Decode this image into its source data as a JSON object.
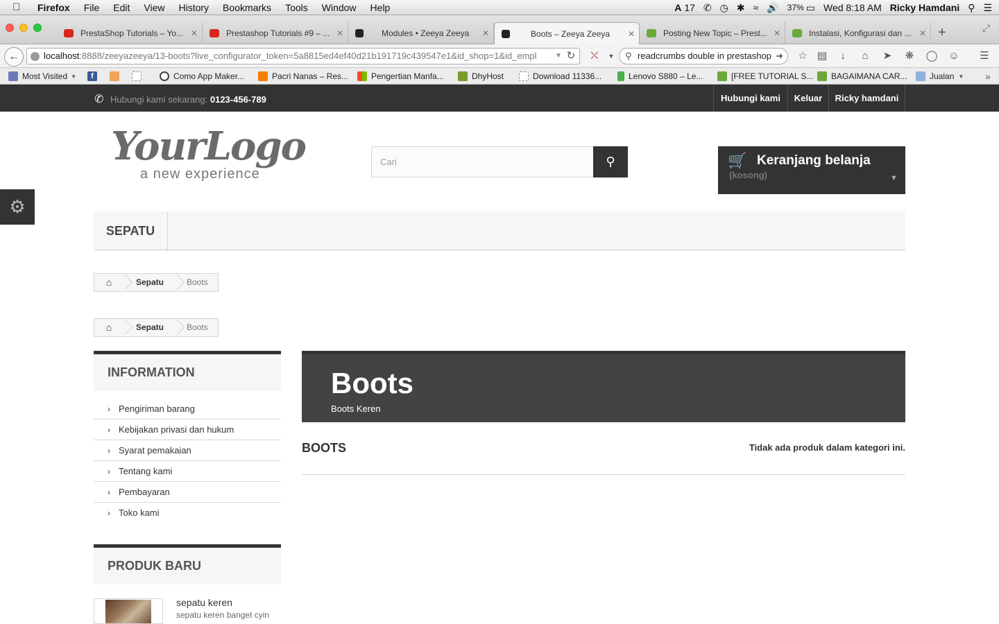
{
  "os_menubar": {
    "app": "Firefox",
    "menus": [
      "File",
      "Edit",
      "View",
      "History",
      "Bookmarks",
      "Tools",
      "Window",
      "Help"
    ],
    "adobe_count": "17",
    "battery": "37%",
    "clock": "Wed 8:18 AM",
    "user": "Ricky Hamdani"
  },
  "browser": {
    "tabs": [
      {
        "label": "PrestaShop Tutorials – Yo...",
        "color": "#d8261f"
      },
      {
        "label": "Prestashop Tutorials #9 – ...",
        "color": "#d8261f"
      },
      {
        "label": "Modules • Zeeya Zeeya",
        "color": "#222222"
      },
      {
        "label": "Boots – Zeeya Zeeya",
        "color": "#222222"
      },
      {
        "label": "Posting New Topic – Prest...",
        "color": "#6aa83a"
      },
      {
        "label": "Instalasi, Konfigurasi dan ...",
        "color": "#6aa83a"
      }
    ],
    "url_host": "localhost",
    "url_rest": ":8888/zeeyazeeya/13-boots?live_configurator_token=5a8815ed4ef40d21b191719c439547e1&id_shop=1&id_empl",
    "search_query": "readcrumbs double in prestashop",
    "bookmarks": [
      {
        "label": "Most Visited",
        "color": "#6b7bb8"
      },
      {
        "label": "",
        "color": "#3b5998"
      },
      {
        "label": "",
        "color": "#f2a35b"
      },
      {
        "label": "",
        "color": "#dddddd"
      },
      {
        "label": "Como App Maker...",
        "color": "#444444"
      },
      {
        "label": "Pacri Nanas – Res...",
        "color": "#f57d00"
      },
      {
        "label": "Pengertian Manfa...",
        "color": "#5ba52f"
      },
      {
        "label": "DhyHost",
        "color": "#7a9d2a"
      },
      {
        "label": "Download 11336...",
        "color": "#dddddd"
      },
      {
        "label": "Lenovo S880 – Le...",
        "color": "#4caf50"
      },
      {
        "label": "[FREE TUTORIAL S...",
        "color": "#6aa83a"
      },
      {
        "label": "BAGAIMANA CAR...",
        "color": "#6aa83a"
      },
      {
        "label": "Jualan",
        "color": "#8fb3e0"
      }
    ]
  },
  "store": {
    "contact_label": "Hubungi kami sekarang:",
    "contact_phone": "0123-456-789",
    "top_links": [
      "Hubungi kami",
      "Keluar",
      "Ricky hamdani"
    ],
    "logo_main": "YourLogo",
    "logo_sub": "a new experience",
    "search_placeholder": "Cari",
    "cart_title": "Keranjang belanja",
    "cart_status": "(kosong)",
    "menu_item": "SEPATU",
    "breadcrumb": [
      "Sepatu",
      "Boots"
    ],
    "info_title": "INFORMATION",
    "info_links": [
      "Pengiriman barang",
      "Kebijakan privasi dan hukum",
      "Syarat pemakaian",
      "Tentang kami",
      "Pembayaran",
      "Toko kami"
    ],
    "new_products_title": "PRODUK BARU",
    "new_product_name": "sepatu keren",
    "new_product_desc": "sepatu keren banget cyin",
    "category_title": "Boots",
    "category_desc": "Boots Keren",
    "category_heading": "BOOTS",
    "category_empty": "Tidak ada produk dalam kategori ini."
  }
}
